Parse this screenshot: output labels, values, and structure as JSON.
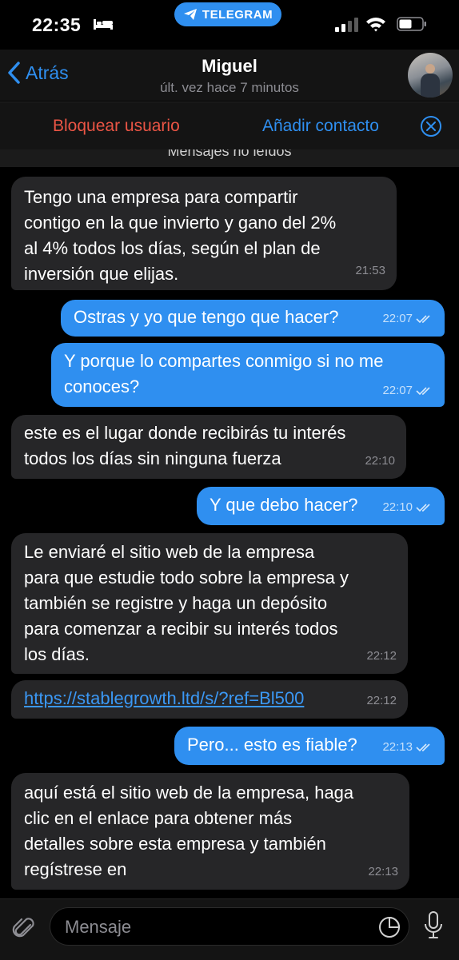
{
  "status_bar": {
    "time": "22:35",
    "app_pill": "TELEGRAM",
    "icons": [
      "bed-icon",
      "signal-icon",
      "wifi-icon",
      "battery-icon"
    ]
  },
  "header": {
    "back_label": "Atrás",
    "contact_name": "Miguel",
    "last_seen": "últ. vez hace 7 minutos"
  },
  "action_bar": {
    "block_label": "Bloquear usuario",
    "add_contact_label": "Añadir contacto"
  },
  "unread_divider": "Mensajes no leídos",
  "messages": [
    {
      "dir": "in",
      "text": "Tengo una empresa para compartir\ncontigo en la que invierto y gano del 2%\nal 4% todos los días, según el plan de\ninversión que elijas.",
      "time": "21:53"
    },
    {
      "dir": "out",
      "text": "Ostras y yo que tengo que hacer?",
      "time": "22:07",
      "read": true
    },
    {
      "dir": "out",
      "text": "Y porque lo compartes conmigo si no me\nconoces?",
      "time": "22:07",
      "read": true
    },
    {
      "dir": "in",
      "text": "este es el lugar donde recibirás tu interés\ntodos los días sin ninguna fuerza",
      "time": "22:10"
    },
    {
      "dir": "out",
      "text": "Y que debo hacer?",
      "time": "22:10",
      "read": true
    },
    {
      "dir": "in",
      "text": "Le enviaré el sitio web de la empresa\npara que estudie todo sobre la empresa y\ntambién se registre y haga un depósito\npara comenzar a recibir su interés todos\nlos días.",
      "time": "22:12"
    },
    {
      "dir": "in",
      "text": "https://stablegrowth.ltd/s/?ref=Bl500",
      "time": "22:12",
      "link": true
    },
    {
      "dir": "out",
      "text": "Pero... esto es fiable?",
      "time": "22:13",
      "read": true
    },
    {
      "dir": "in",
      "text": "aquí está el sitio web de la empresa, haga\nclic en el enlace para obtener más\ndetalles sobre esta empresa y también\nregístrese en",
      "time": "22:13"
    }
  ],
  "input_bar": {
    "placeholder": "Mensaje"
  },
  "colors": {
    "accent": "#2f8ff0",
    "danger": "#eb5545",
    "incoming_bubble": "#262628",
    "outgoing_bubble": "#2f8ff0",
    "background": "#000000"
  }
}
